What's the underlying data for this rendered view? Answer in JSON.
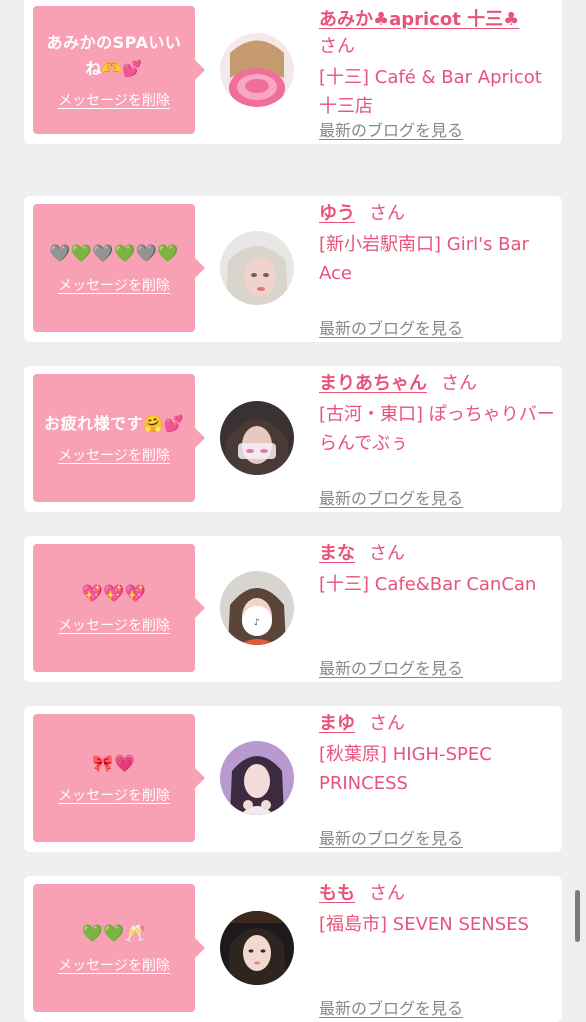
{
  "items": [
    {
      "message": "あみかのSPAいいね🫶💕",
      "delete_label": "メッセージを削除",
      "name": "あみか♣apricot 十三♣",
      "honorific": "さん",
      "shop": "[十三] Café & Bar Apricot 十三店",
      "blog_label": "最新のブログを見る",
      "avatar": "avatar-pink-hair"
    },
    {
      "message": "🩶💚🩶💚🩶💚",
      "delete_label": "メッセージを削除",
      "name": "ゆう",
      "honorific": "さん",
      "shop": "[新小岩駅南口] Girl's Bar Ace",
      "blog_label": "最新のブログを見る",
      "avatar": "avatar-blonde"
    },
    {
      "message": "お疲れ様です🤗💕",
      "delete_label": "メッセージを削除",
      "name": "まりあちゃん",
      "honorific": "さん",
      "shop": "[古河・東口] ぽっちゃりバー らんでぶぅ",
      "blog_label": "最新のブログを見る",
      "avatar": "avatar-dark-hair"
    },
    {
      "message": "💖💖💖",
      "delete_label": "メッセージを削除",
      "name": "まな",
      "honorific": "さん",
      "shop": "[十三] Cafe&Bar CanCan",
      "blog_label": "最新のブログを見る",
      "avatar": "avatar-face-covered"
    },
    {
      "message": "🎀💗",
      "delete_label": "メッセージを削除",
      "name": "まゆ",
      "honorific": "さん",
      "shop": "[秋葉原] HIGH-SPEC PRINCESS",
      "blog_label": "最新のブログを見る",
      "avatar": "avatar-purple"
    },
    {
      "message": "💚💚🥂",
      "delete_label": "メッセージを削除",
      "name": "もも",
      "honorific": "さん",
      "shop": "[福島市] SEVEN SENSES",
      "blog_label": "最新のブログを見る",
      "avatar": "avatar-dark-night"
    }
  ],
  "colors": {
    "accent": "#e8537a",
    "bubble": "#f8a0b4",
    "background": "#f0efef"
  }
}
